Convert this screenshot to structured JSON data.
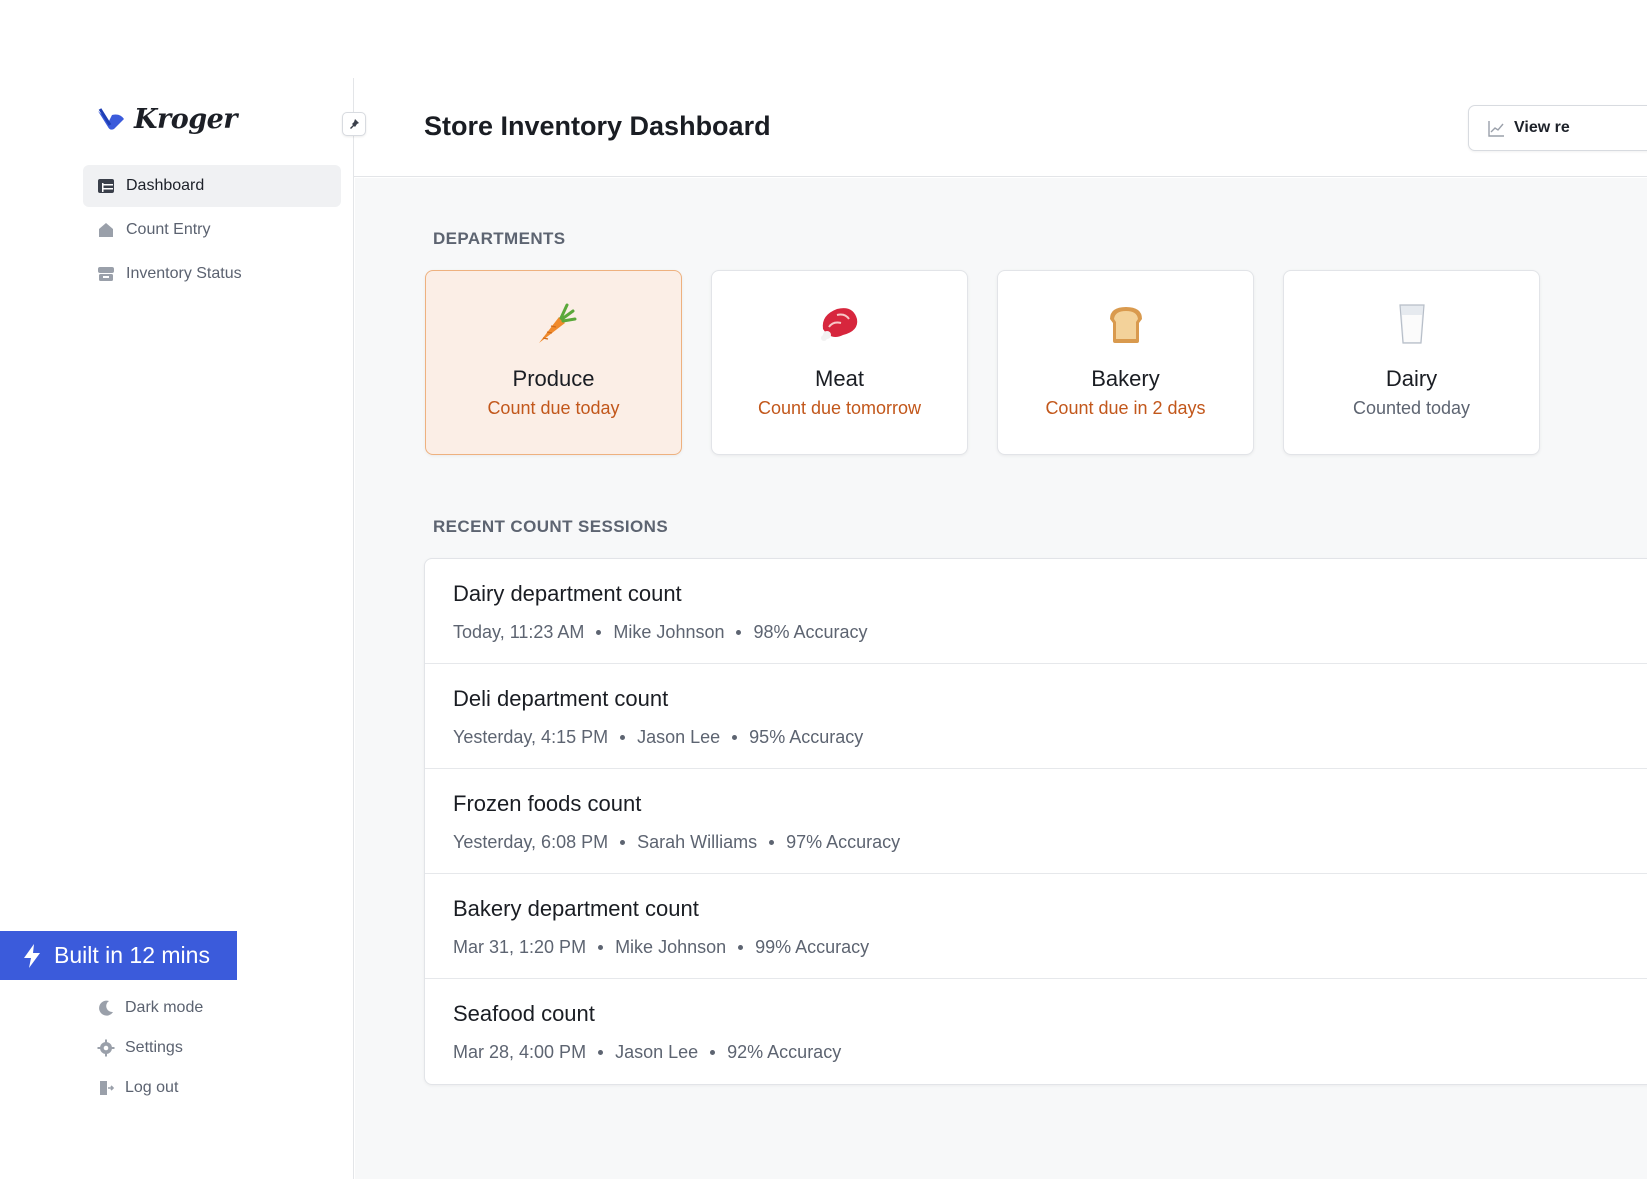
{
  "brand": {
    "name": "Kroger",
    "accent": "#3b5bdb"
  },
  "sidebar": {
    "items": [
      {
        "label": "Dashboard",
        "icon": "table-icon",
        "active": true
      },
      {
        "label": "Count Entry",
        "icon": "house-icon",
        "active": false
      },
      {
        "label": "Inventory Status",
        "icon": "store-icon",
        "active": false
      }
    ],
    "bottom_items": [
      {
        "label": "Dark mode",
        "icon": "moon-icon"
      },
      {
        "label": "Settings",
        "icon": "gear-icon"
      },
      {
        "label": "Log out",
        "icon": "logout-icon"
      }
    ],
    "badge": "Built in 12 mins"
  },
  "header": {
    "title": "Store Inventory Dashboard",
    "view_button": "View re"
  },
  "departments": {
    "label": "DEPARTMENTS",
    "cards": [
      {
        "icon": "carrot-icon",
        "name": "Produce",
        "status": "Count due today",
        "selected": true
      },
      {
        "icon": "meat-icon",
        "name": "Meat",
        "status": "Count due tomorrow",
        "selected": false
      },
      {
        "icon": "bread-icon",
        "name": "Bakery",
        "status": "Count due in 2 days",
        "selected": false
      },
      {
        "icon": "milk-icon",
        "name": "Dairy",
        "status": "Counted today",
        "selected": false
      }
    ]
  },
  "sessions": {
    "label": "RECENT COUNT SESSIONS",
    "rows": [
      {
        "title": "Dairy department count",
        "time": "Today, 11:23 AM",
        "user": "Mike Johnson",
        "accuracy": "98% Accuracy"
      },
      {
        "title": "Deli department count",
        "time": "Yesterday, 4:15 PM",
        "user": "Jason Lee",
        "accuracy": "95% Accuracy"
      },
      {
        "title": "Frozen foods count",
        "time": "Yesterday, 6:08 PM",
        "user": "Sarah Williams",
        "accuracy": "97% Accuracy"
      },
      {
        "title": "Bakery department count",
        "time": "Mar 31, 1:20 PM",
        "user": "Mike Johnson",
        "accuracy": "99% Accuracy"
      },
      {
        "title": "Seafood count",
        "time": "Mar 28, 4:00 PM",
        "user": "Jason Lee",
        "accuracy": "92% Accuracy"
      }
    ]
  }
}
